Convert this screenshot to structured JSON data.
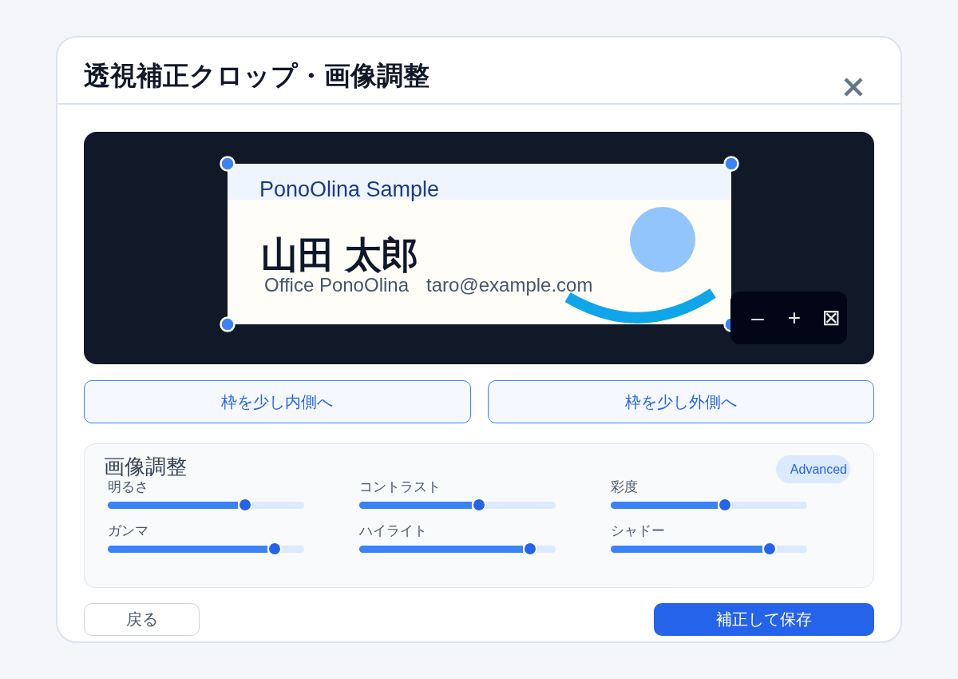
{
  "dialog": {
    "title": "透視補正クロップ・画像調整"
  },
  "preview": {
    "card": {
      "header": "PonoOlina Sample",
      "name": "山田 太郎",
      "company": "Office PonoOlina",
      "email": "taro@example.com"
    },
    "zoom_controls": [
      "–",
      "+",
      "⊠"
    ]
  },
  "frame_buttons": [
    "枠を少し内側へ",
    "枠を少し外側へ"
  ],
  "adjustments": {
    "title": "画像調整",
    "mode_badge": "Advanced",
    "sliders": [
      {
        "label": "明るさ",
        "level": 0.7
      },
      {
        "label": "コントラスト",
        "level": 0.61
      },
      {
        "label": "彩度",
        "level": 0.58
      },
      {
        "label": "ガンマ",
        "level": 0.85
      },
      {
        "label": "ハイライト",
        "level": 0.87
      },
      {
        "label": "シャドー",
        "level": 0.81
      }
    ]
  },
  "footer_buttons": [
    {
      "label": "戻る",
      "kind": "secondary"
    },
    {
      "label": "補正して保存",
      "kind": "primary"
    }
  ]
}
